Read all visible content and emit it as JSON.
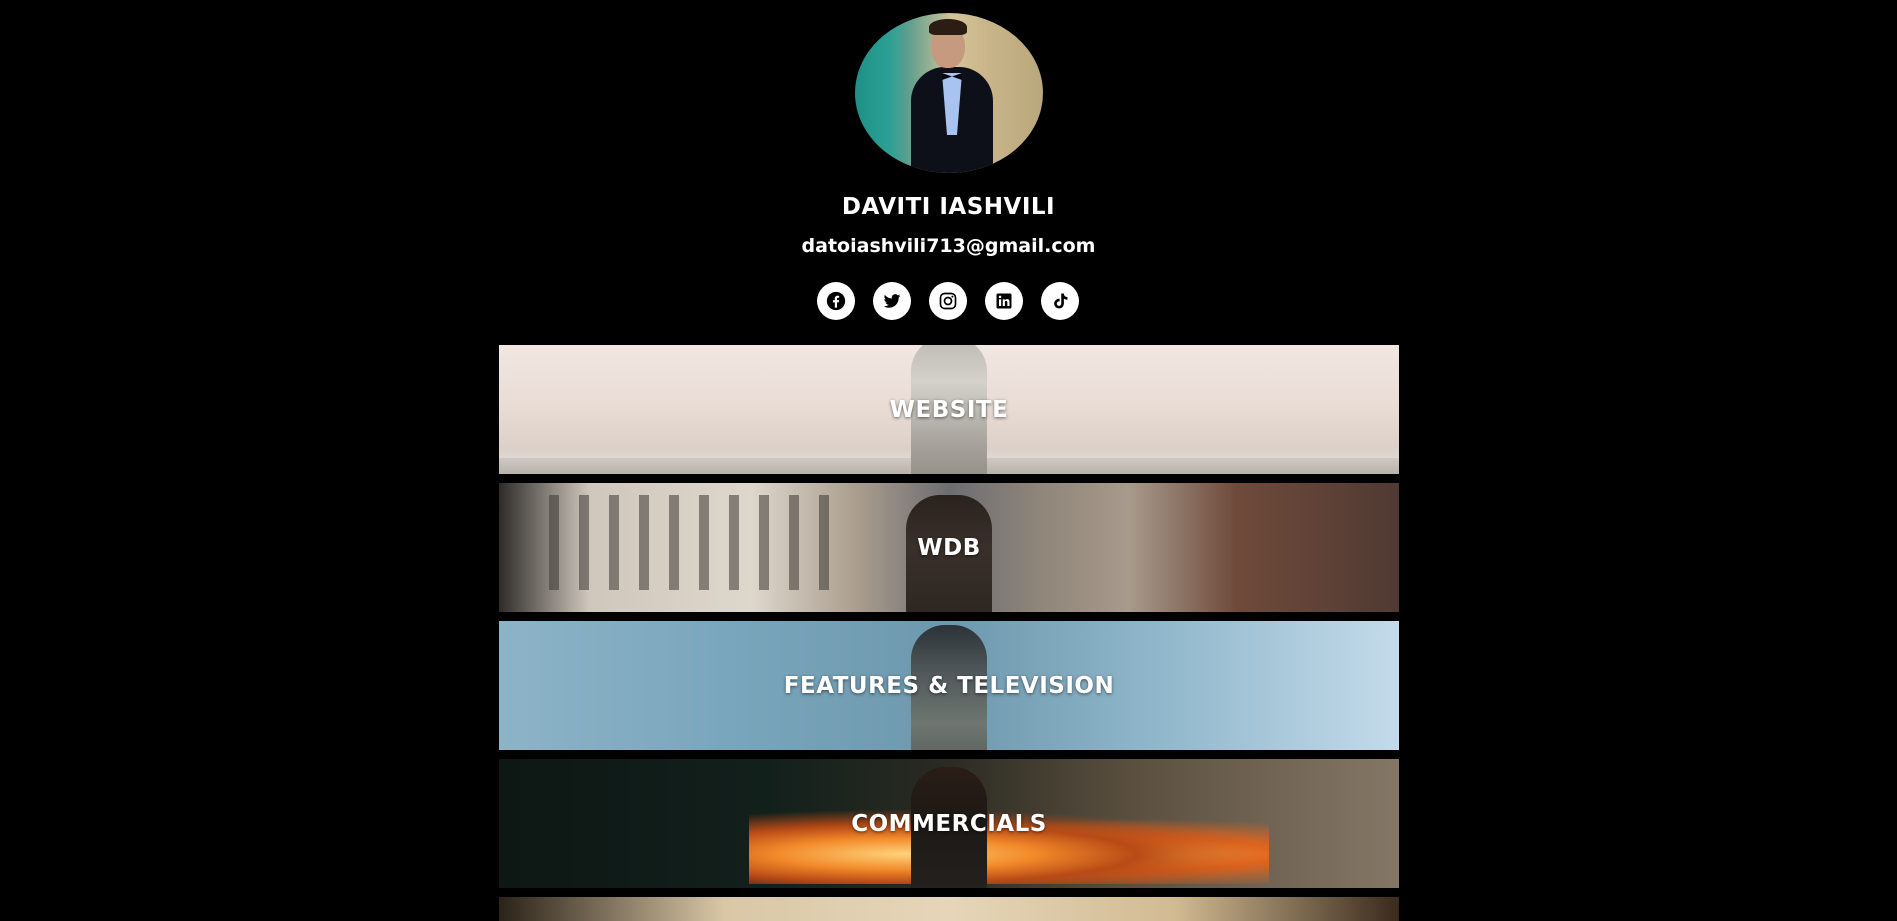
{
  "profile": {
    "name": "DAVITI IASHVILI",
    "email": "datoiashvili713@gmail.com"
  },
  "socials": [
    {
      "name": "facebook",
      "icon": "facebook-icon"
    },
    {
      "name": "twitter",
      "icon": "twitter-icon"
    },
    {
      "name": "instagram",
      "icon": "instagram-icon"
    },
    {
      "name": "linkedin",
      "icon": "linkedin-icon"
    },
    {
      "name": "tiktok",
      "icon": "tiktok-icon"
    }
  ],
  "links": [
    {
      "label": "WEBSITE"
    },
    {
      "label": "WDB"
    },
    {
      "label": "FEATURES & TELEVISION"
    },
    {
      "label": "COMMERCIALS"
    },
    {
      "label": ""
    }
  ],
  "colors": {
    "background": "#000000",
    "text": "#ffffff",
    "icon_bg": "#ffffff",
    "icon_fg": "#000000"
  }
}
